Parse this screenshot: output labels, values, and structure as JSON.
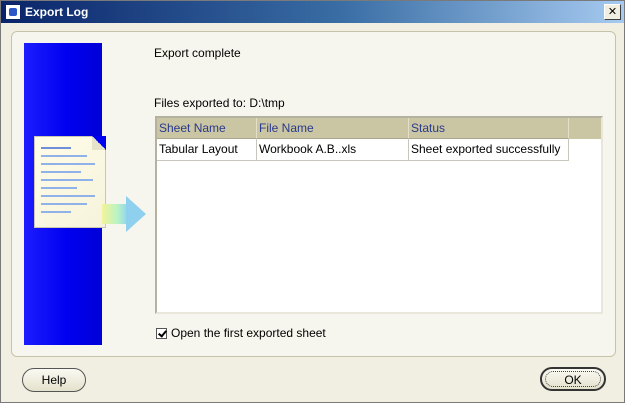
{
  "window": {
    "title": "Export Log",
    "close_glyph": "✕"
  },
  "status": {
    "message": "Export complete",
    "files_exported_to": "Files exported to: D:\\tmp"
  },
  "table": {
    "columns": [
      "Sheet Name",
      "File Name",
      "Status"
    ],
    "rows": [
      {
        "sheet_name": "Tabular Layout",
        "file_name": "Workbook A.B..xls",
        "status": "Sheet exported successfully"
      }
    ]
  },
  "options": {
    "open_first_label": "Open the first exported sheet",
    "open_first_checked": true
  },
  "buttons": {
    "help": "Help",
    "ok": "OK"
  },
  "icons": {
    "title_icon": "app-window-icon",
    "close": "close-icon",
    "side_image": "export-document-illustration"
  }
}
